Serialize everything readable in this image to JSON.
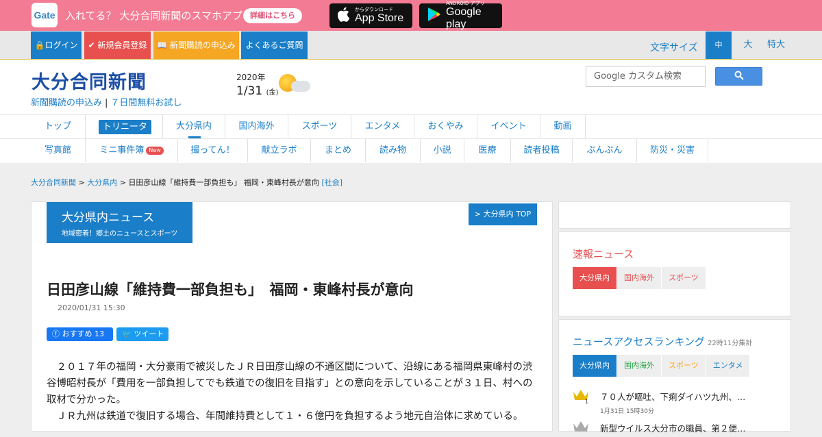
{
  "app_bar": {
    "gate_logo": "Gate",
    "promo_text": "入れてる？ 大分合同新聞のスマホアプリ",
    "detail_button": "詳細はこちら",
    "appstore_small": "からダウンロード",
    "appstore_big": "App Store",
    "gplay_small": "ANDROID アプリ",
    "gplay_big": "Google play"
  },
  "top_nav": {
    "login": "ログイン",
    "register": "新規会員登録",
    "subscribe": "新聞購読の申込み",
    "faq": "よくあるご質問",
    "font_size_label": "文字サイズ",
    "font_sizes": [
      "中",
      "大",
      "特大"
    ],
    "font_size_selected": "中"
  },
  "colors": {
    "brand_blue": "#1a7ec8",
    "app_bar_pink": "#f37b93",
    "login_bg": "#1a7ec8",
    "register_bg": "#e8504f",
    "subscribe_bg": "#f5a623",
    "faq_bg": "#1a7ec8"
  },
  "header": {
    "logo": "大分合同新聞",
    "link_subscribe": "新聞購読の申込み",
    "link_trial": "７日間無料お試し",
    "link_separator": "|",
    "year": "2020年",
    "date": "1/31",
    "weekday": "(金)",
    "weather_icon": "sun-cloud-icon",
    "search_placeholder": "Google カスタム検索"
  },
  "nav_main": [
    "トップ",
    "トリニータ",
    "大分県内",
    "国内海外",
    "スポーツ",
    "エンタメ",
    "おくやみ",
    "イベント",
    "動画"
  ],
  "nav_main_active": "大分県内",
  "nav_sub": [
    "写真館",
    "ミニ事件簿",
    "撮ってん！",
    "献立ラボ",
    "まとめ",
    "読み物",
    "小説",
    "医療",
    "読者投稿",
    "ぶんぶん",
    "防災・災害"
  ],
  "nav_sub_badge": "New",
  "breadcrumb": {
    "home": "大分合同新聞",
    "section": "大分県内",
    "current": "日田彦山線「維持費一部負担も」 福岡・東峰村長が意向",
    "category": "[社会]",
    "separator": ">"
  },
  "article": {
    "section_title": "大分県内ニュース",
    "section_subtitle": "地域密着！郷土のニュースとスポーツ",
    "section_top_link": "> 大分県内 TOP",
    "headline": "日田彦山線「維持費一部負担も」　福岡・東峰村長が意向",
    "datetime": "2020/01/31 15:30",
    "fb_label": "おすすめ",
    "fb_count": "13",
    "tweet_label": "ツイート",
    "paragraph1": "２０１７年の福岡・大分豪雨で被災したＪＲ日田彦山線の不通区間について、沿線にある福岡県東峰村の渋谷博昭村長が「費用を一部負担してでも鉄道での復旧を目指す」との意向を示していることが３１日、村への取材で分かった。",
    "paragraph2": "ＪＲ九州は鉄道で復旧する場合、年間維持費として１・６億円を負担するよう地元自治体に求めている。"
  },
  "sidebar": {
    "breaking_title": "速報ニュース",
    "breaking_tabs": [
      "大分県内",
      "国内海外",
      "スポーツ"
    ],
    "ranking_title": "ニュースアクセスランキング",
    "ranking_note": "22時11分集計",
    "ranking_tabs": [
      "大分県内",
      "国内海外",
      "スポーツ",
      "エンタメ"
    ],
    "ranking_items": [
      {
        "rank_icon": "gold-crown-icon",
        "title": "７０人が嘔吐、下痢ダイハツ九州、…",
        "date": "1月31日 15時30分"
      },
      {
        "rank_icon": "silver-crown-icon",
        "title": "新型ウイルス大分市の職員、第２便…",
        "date": ""
      }
    ]
  }
}
